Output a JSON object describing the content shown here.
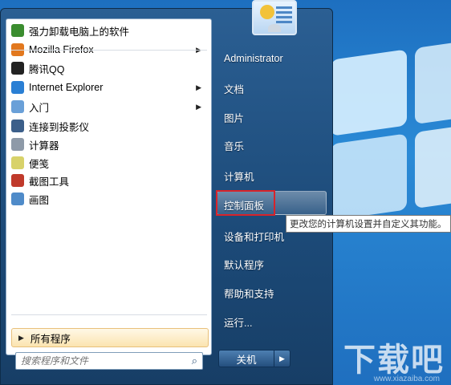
{
  "programs": [
    {
      "label": "强力卸载电脑上的软件",
      "icon": "uninstaller-icon",
      "color": "#3b8d2f",
      "submenu": false
    },
    {
      "label": "Mozilla Firefox",
      "icon": "firefox-icon",
      "color": "#e2781e",
      "submenu": true
    },
    {
      "label": "腾讯QQ",
      "icon": "qq-icon",
      "color": "#222222",
      "submenu": false
    },
    {
      "label": "Internet Explorer",
      "icon": "ie-icon",
      "color": "#2a7fd4",
      "submenu": true
    },
    {
      "label": "入门",
      "icon": "getting-started-icon",
      "color": "#6aa0d8",
      "submenu": true
    },
    {
      "label": "连接到投影仪",
      "icon": "projector-icon",
      "color": "#3c5f8a",
      "submenu": false
    },
    {
      "label": "计算器",
      "icon": "calculator-icon",
      "color": "#8e9aa8",
      "submenu": false
    },
    {
      "label": "便笺",
      "icon": "sticky-notes-icon",
      "color": "#d8d26a",
      "submenu": false
    },
    {
      "label": "截图工具",
      "icon": "snipping-tool-icon",
      "color": "#c03a2b",
      "submenu": false
    },
    {
      "label": "画图",
      "icon": "paint-icon",
      "color": "#4f8bc9",
      "submenu": false
    }
  ],
  "all_programs_label": "所有程序",
  "search": {
    "placeholder": "搜索程序和文件"
  },
  "right_items": [
    {
      "label": "Administrator",
      "key": "administrator"
    },
    {
      "label": "文档",
      "key": "documents"
    },
    {
      "label": "图片",
      "key": "pictures"
    },
    {
      "label": "音乐",
      "key": "music"
    },
    {
      "label": "计算机",
      "key": "computer"
    },
    {
      "label": "控制面板",
      "key": "control-panel"
    },
    {
      "label": "设备和打印机",
      "key": "devices-printers"
    },
    {
      "label": "默认程序",
      "key": "default-programs"
    },
    {
      "label": "帮助和支持",
      "key": "help-support"
    },
    {
      "label": "运行...",
      "key": "run"
    }
  ],
  "tooltip": "更改您的计算机设置并自定义其功能。",
  "shutdown_label": "关机",
  "watermark": "下载吧",
  "watermark_url": "www.xiazaiba.com",
  "colors": {
    "highlight_border": "#d8232a",
    "menu_blue": "#1c4a78"
  }
}
